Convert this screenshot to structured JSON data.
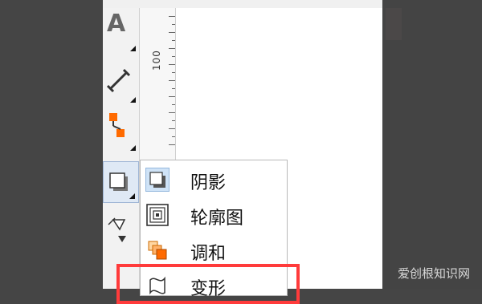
{
  "toolbox": {
    "tools": [
      {
        "name": "text-tool",
        "icon": "text-a-icon"
      },
      {
        "name": "dimension-tool",
        "icon": "dimension-icon"
      },
      {
        "name": "connector-tool",
        "icon": "connector-icon"
      },
      {
        "name": "shadow-tool",
        "icon": "shadow-icon"
      },
      {
        "name": "fill-tool",
        "icon": "fill-bucket-icon"
      }
    ]
  },
  "ruler": {
    "label": "100"
  },
  "flyout": {
    "items": [
      {
        "label": "阴影",
        "icon": "drop-shadow-icon"
      },
      {
        "label": "轮廓图",
        "icon": "contour-icon"
      },
      {
        "label": "调和",
        "icon": "blend-icon"
      },
      {
        "label": "变形",
        "icon": "distort-icon"
      }
    ]
  },
  "watermark": {
    "text": "爱创根知识网"
  },
  "colors": {
    "highlight": "#ff3b3b",
    "accent_orange": "#ff6a00",
    "selection_blue": "#cfe3f7"
  }
}
